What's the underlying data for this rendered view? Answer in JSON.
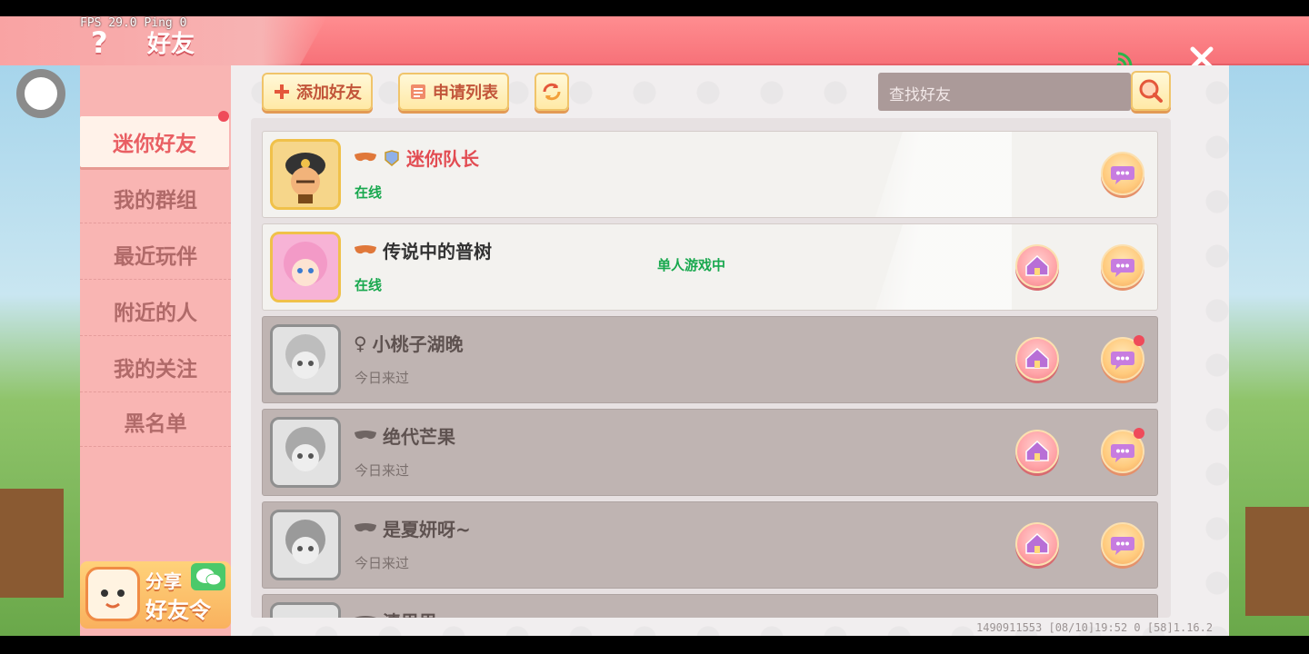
{
  "debug": {
    "fps_ping": "FPS 29.0  Ping 0"
  },
  "header": {
    "title": "好友",
    "help_glyph": "?"
  },
  "sidebar": {
    "items": [
      {
        "label": "迷你好友",
        "active": true,
        "badge": true
      },
      {
        "label": "我的群组"
      },
      {
        "label": "最近玩伴"
      },
      {
        "label": "附近的人"
      },
      {
        "label": "我的关注"
      },
      {
        "label": "黑名单"
      }
    ],
    "share": {
      "line1": "分享",
      "line2": "好友令"
    }
  },
  "toolbar": {
    "add_friend": "添加好友",
    "request_list": "申请列表",
    "search_placeholder": "查找好友"
  },
  "friends": [
    {
      "name": "迷你队长",
      "status": "在线",
      "online": true,
      "activity": ""
    },
    {
      "name": "传说中的普树",
      "status": "在线",
      "online": true,
      "activity": "单人游戏中"
    },
    {
      "name": "小桃子湖晚",
      "status": "今日来过",
      "online": false,
      "gender": "♀",
      "chat_badge": true
    },
    {
      "name": "绝代芒果",
      "status": "今日来过",
      "online": false,
      "chat_badge": true
    },
    {
      "name": "是夏妍呀~",
      "status": "今日来过",
      "online": false
    },
    {
      "name": "清思思",
      "status": "",
      "online": false
    }
  ],
  "footer": {
    "info": "1490911553   [08/10]19:52 0   [58]1.16.2"
  },
  "colors": {
    "header": "#f77279",
    "sidebar": "#f9b5b3",
    "online_green": "#18a84e",
    "badge_red": "#ef4b5a"
  }
}
